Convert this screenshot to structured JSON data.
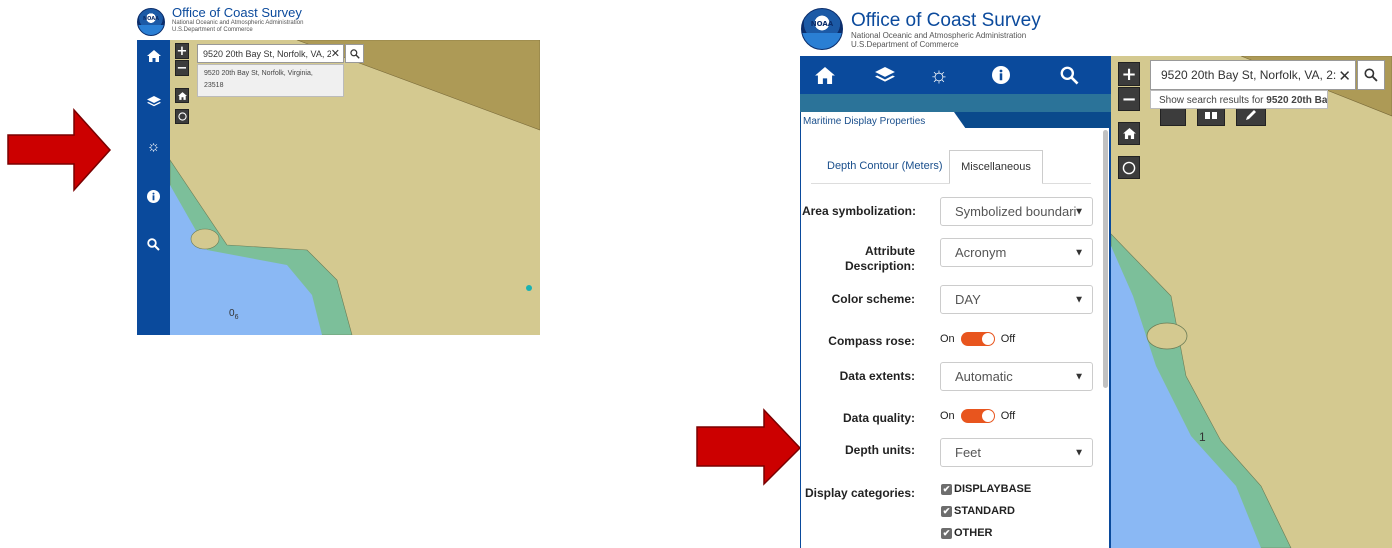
{
  "colors": {
    "sidebar": "#0a4a9c",
    "land": "#d4c990",
    "land_dark": "#ad9a56",
    "water": "#8ab8f4",
    "shoal": "#7cbf9a",
    "arrow": "#cc0000",
    "toggle": "#e8551e"
  },
  "left": {
    "header": {
      "title": "Office of Coast Survey",
      "sub1": "National Oceanic and Atmospheric Administration",
      "sub2": "U.S.Department of Commerce",
      "logo_text": "NOAA"
    },
    "zoom_in": "+",
    "zoom_out": "−",
    "search": {
      "value": "9520 20th Bay St, Norfolk, VA, 2:",
      "clear": "✕"
    },
    "suggestion": {
      "line1": "9520 20th Bay St, Norfolk, Virginia,",
      "line2": "23518"
    },
    "sounding": "0",
    "sounding_sub": "6"
  },
  "right": {
    "header": {
      "title": "Office of Coast Survey",
      "sub1": "National Oceanic and Atmospheric Administration",
      "sub2": "U.S.Department of Commerce",
      "logo_text": "NOAA"
    },
    "zoom_in": "+",
    "zoom_out": "−",
    "search": {
      "value": "9520 20th Bay St, Norfolk, VA, 2:",
      "clear": "✕"
    },
    "suggestion_prefix": "Show search results for ",
    "suggestion_bold": "9520 20th Ba...",
    "panel_tab": "Maritime Display Properties",
    "subtabs": [
      "Depth Contour (Meters)",
      "Miscellaneous"
    ],
    "rows": {
      "area_symbolization": {
        "label": "Area symbolization:",
        "value": "Symbolized boundari"
      },
      "attribute_description": {
        "label1": "Attribute",
        "label2": "Description:",
        "value": "Acronym"
      },
      "color_scheme": {
        "label": "Color scheme:",
        "value": "DAY"
      },
      "compass_rose": {
        "label": "Compass rose:",
        "on": "On",
        "off": "Off"
      },
      "data_extents": {
        "label": "Data extents:",
        "value": "Automatic"
      },
      "data_quality": {
        "label": "Data quality:",
        "on": "On",
        "off": "Off"
      },
      "depth_units": {
        "label": "Depth units:",
        "value": "Feet"
      },
      "display_categories": {
        "label": "Display categories:",
        "items": [
          "DISPLAYBASE",
          "STANDARD",
          "OTHER"
        ]
      }
    },
    "sounding": "1"
  }
}
